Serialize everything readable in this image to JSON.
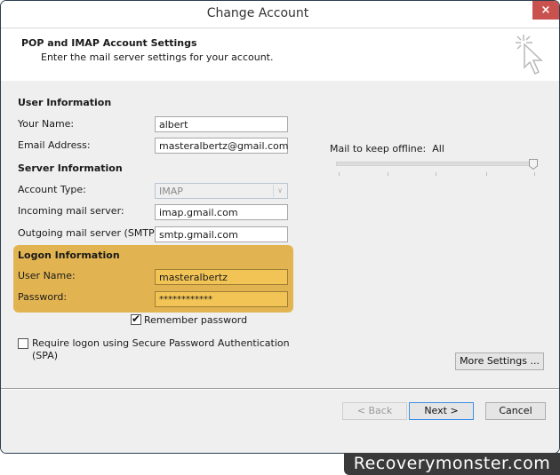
{
  "window": {
    "title": "Change Account",
    "close_label": "×"
  },
  "header": {
    "title": "POP and IMAP Account Settings",
    "subtitle": "Enter the mail server settings for your account."
  },
  "user_info": {
    "section": "User Information",
    "name_label": "Your Name:",
    "name_value": "albert",
    "email_label": "Email Address:",
    "email_value": "masteralbertz@gmail.com"
  },
  "server_info": {
    "section": "Server Information",
    "account_type_label": "Account Type:",
    "account_type_value": "IMAP",
    "incoming_label": "Incoming mail server:",
    "incoming_value": "imap.gmail.com",
    "outgoing_label": "Outgoing mail server (SMTP):",
    "outgoing_value": "smtp.gmail.com"
  },
  "logon_info": {
    "section": "Logon Information",
    "user_label": "User Name:",
    "user_value": "masteralbertz",
    "password_label": "Password:",
    "password_value": "************",
    "highlight_color": "#e2b451"
  },
  "remember_password": {
    "label": "Remember password",
    "checked": true
  },
  "spa": {
    "label_line1": "Require logon using Secure Password Authentication",
    "label_line2": "(SPA)",
    "checked": false
  },
  "offline": {
    "label": "Mail to keep offline:",
    "value": "All",
    "slider_position": 1.0
  },
  "buttons": {
    "more_settings": "More Settings ...",
    "back": "< Back",
    "next": "Next >",
    "cancel": "Cancel"
  },
  "watermark": "Recoverymonster.com"
}
